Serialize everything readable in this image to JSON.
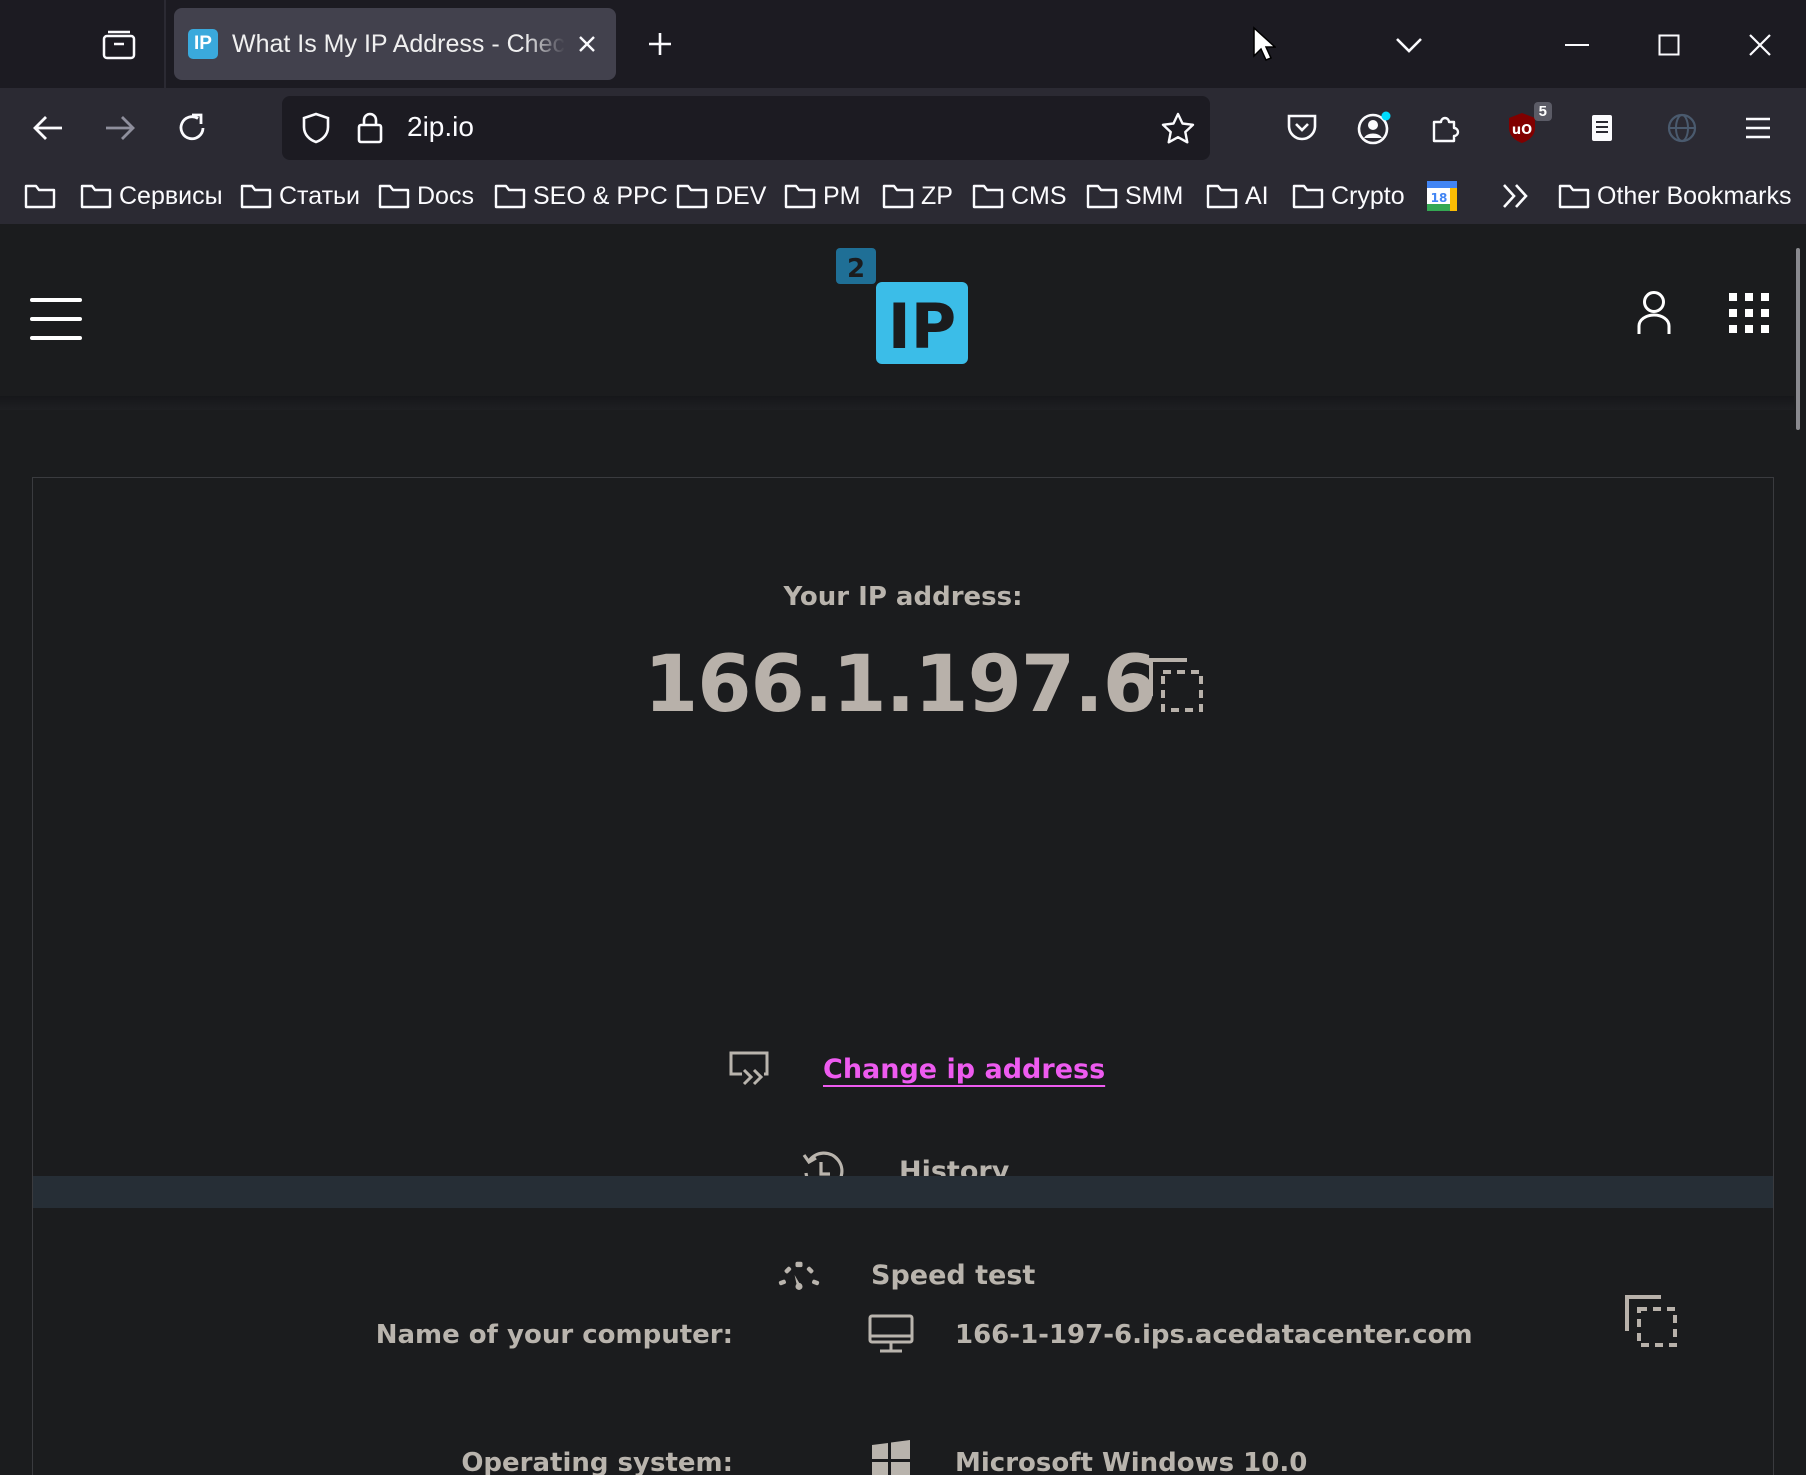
{
  "browser": {
    "tab_title": "What Is My IP Address - Check your",
    "tab_favicon": "IP",
    "url": "2ip.io",
    "ublock_badge": "5",
    "bookmarks": [
      "Сервисы",
      "Статьи",
      "Docs",
      "SEO & PPC",
      "DEV",
      "PM",
      "ZP",
      "CMS",
      "SMM",
      "AI",
      "Crypto"
    ],
    "calendar_badge": "18",
    "other_bookmarks": "Other Bookmarks"
  },
  "site": {
    "logo_number": "2",
    "logo_text": "IP"
  },
  "main": {
    "ip_label": "Your IP address:",
    "ip_value": "166.1.197.6",
    "actions": {
      "change_ip": "Change ip address",
      "history": "History",
      "speed_test": "Speed test"
    },
    "info": {
      "computer_name_label": "Name of your computer:",
      "computer_name_value": "166-1-197-6.ips.acedatacenter.com",
      "os_label": "Operating system:",
      "os_value": "Microsoft Windows 10.0"
    }
  },
  "colors": {
    "link_accent": "#ee5bf0",
    "logo_blue": "#3bbde8",
    "logo_dark_blue": "#1f6f96",
    "page_background": "#1b1c1e",
    "text_muted": "#b9b4ad"
  }
}
